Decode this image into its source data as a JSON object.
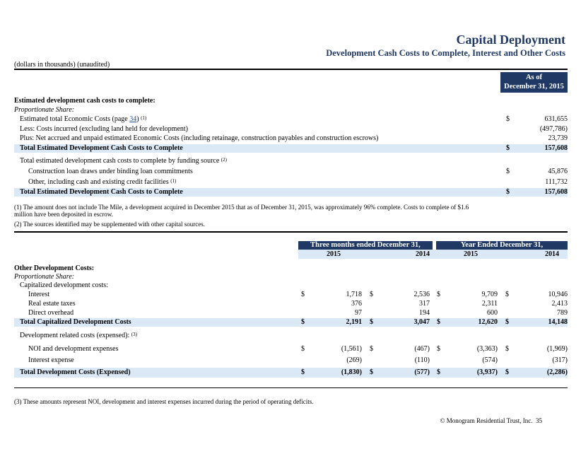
{
  "header": {
    "title": "Capital Deployment",
    "subtitle": "Development Cash Costs to Complete, Interest and Other Costs",
    "units": "(dollars in thousands) (unaudited)"
  },
  "section1": {
    "col_header_line1": "As of",
    "col_header_line2": "December 31, 2015",
    "heading": "Estimated development cash costs to complete:",
    "subheading": "Proportionate Share:",
    "rows": [
      {
        "label_prefix": "Estimated total Economic Costs (page ",
        "link": "34",
        "label_suffix": ")",
        "sup": "(1)",
        "dollar": "$",
        "value": "631,655"
      },
      {
        "label": "Less:  Costs incurred (excluding land held for development)",
        "dollar": "",
        "value": "(497,786)"
      },
      {
        "label": "Plus:  Net accrued and unpaid estimated Economic Costs (including retainage, construction payables and construction escrows)",
        "dollar": "",
        "value": "23,739"
      }
    ],
    "total1": {
      "label": "Total Estimated Development Cash Costs to Complete",
      "dollar": "$",
      "value": "157,608"
    },
    "funding_label": "Total estimated development cash costs to complete by funding source",
    "funding_sup": "(2)",
    "funding_rows": [
      {
        "label": "Construction loan draws under binding loan commitments",
        "sup": "",
        "dollar": "$",
        "value": "45,876"
      },
      {
        "label": "Other, including cash and existing credit facilities",
        "sup": "(1)",
        "dollar": "",
        "value": "111,732"
      }
    ],
    "total2": {
      "label": "Total Estimated Development Cash Costs to Complete",
      "dollar": "$",
      "value": "157,608"
    },
    "note1_line1": "(1) The amount does not include The Mile, a development acquired in December 2015 that as of December 31, 2015, was approximately 96% complete.  Costs to complete of  $1.6",
    "note1_line2": "million have been deposited in escrow.",
    "note2": "(2) The sources identified may be supplemented with other capital sources."
  },
  "section2": {
    "group1": "Three months ended December 31,",
    "group2": "Year Ended December 31,",
    "years": [
      "2015",
      "2014",
      "2015",
      "2014"
    ],
    "heading": "Other Development Costs:",
    "subheading": "Proportionate Share:",
    "cap_label": "Capitalized development costs:",
    "cap_rows": [
      {
        "label": "Interest",
        "dollar": true,
        "values": [
          "1,718",
          "2,536",
          "9,709",
          "10,946"
        ]
      },
      {
        "label": "Real estate taxes",
        "dollar": false,
        "values": [
          "376",
          "317",
          "2,311",
          "2,413"
        ]
      },
      {
        "label": "Direct overhead",
        "dollar": false,
        "values": [
          "97",
          "194",
          "600",
          "789"
        ]
      }
    ],
    "cap_total": {
      "label": "Total Capitalized Development Costs",
      "values": [
        "2,191",
        "3,047",
        "12,620",
        "14,148"
      ]
    },
    "exp_label": "Development related costs (expensed):",
    "exp_sup": "(3)",
    "exp_rows": [
      {
        "label": "NOI and development expenses",
        "dollar": true,
        "values": [
          "(1,561)",
          "(467)",
          "(3,363)",
          "(1,969)"
        ]
      },
      {
        "label": "Interest expense",
        "dollar": false,
        "values": [
          "(269)",
          "(110)",
          "(574)",
          "(317)"
        ]
      }
    ],
    "exp_total": {
      "label": "Total Development Costs (Expensed)",
      "values": [
        "(1,830)",
        "(577)",
        "(3,937)",
        "(2,286)"
      ]
    },
    "note3": "(3) These amounts represent NOI, development and interest expenses incurred during the period of operating deficits."
  },
  "footer": {
    "text": "© Monogram Residential Trust, Inc.",
    "page": "35"
  },
  "colors": {
    "navy": "#1f3864",
    "total_band": "#dbe9f6"
  }
}
